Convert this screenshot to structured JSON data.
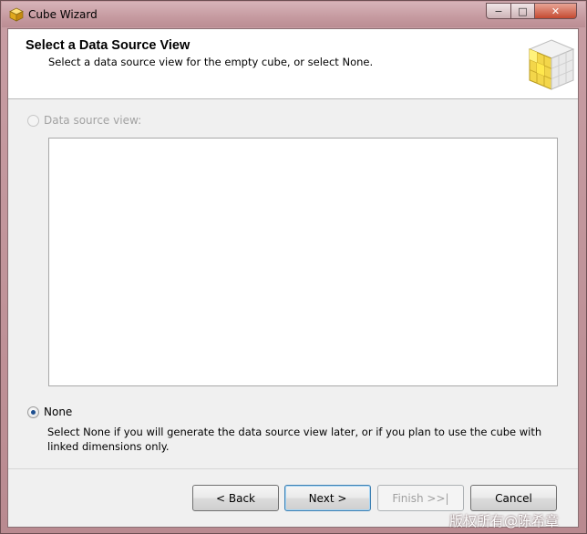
{
  "window": {
    "title": "Cube Wizard",
    "controls": {
      "minimize": "−",
      "maximize": "□",
      "close": "✕"
    }
  },
  "header": {
    "title": "Select a Data Source View",
    "subtitle": "Select a data source view for the empty cube, or select None."
  },
  "options": {
    "data_source_view": {
      "label": "Data source view:",
      "enabled": false,
      "selected": false
    },
    "none": {
      "label": "None",
      "selected": true,
      "description": "Select None if you will generate the data source view later, or if you plan to use the cube with linked dimensions only."
    }
  },
  "buttons": {
    "back": "< Back",
    "next": "Next >",
    "finish": "Finish >>|",
    "cancel": "Cancel"
  },
  "watermark": "版权所有@陈希章"
}
